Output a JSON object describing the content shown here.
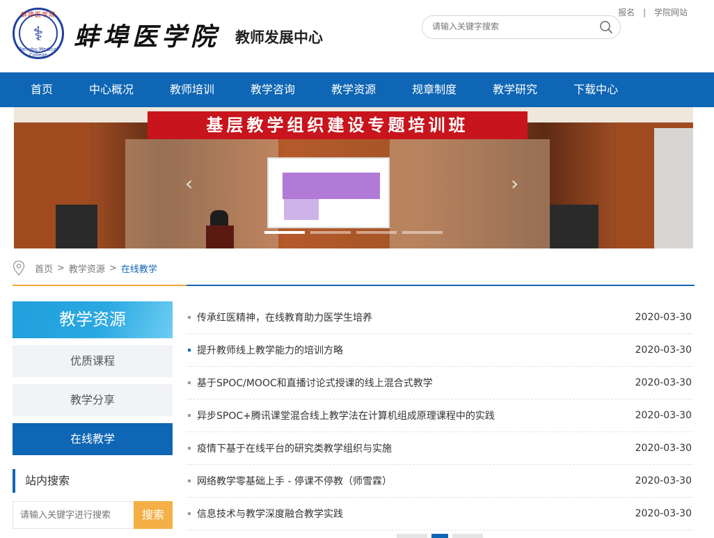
{
  "header": {
    "college_name": "蚌埠医学院",
    "center_name": "教师发展中心",
    "logo_ring_top": "蚌埠医学院",
    "logo_ring_bottom": "Bengbu Medical College",
    "top_links": [
      "报名",
      "学院网站"
    ],
    "top_link_separator": "|",
    "search_placeholder": "请输入关键字搜索"
  },
  "nav": {
    "items": [
      "首页",
      "中心概况",
      "教师培训",
      "教学咨询",
      "教学资源",
      "规章制度",
      "教学研究",
      "下载中心"
    ]
  },
  "banner": {
    "headline": "基层教学组织建设专题培训班",
    "slide_count": 4,
    "active_slide": 1
  },
  "breadcrumb": {
    "items": [
      "首页",
      "教学资源",
      "在线教学"
    ],
    "separator": ">"
  },
  "sidebar": {
    "heading": "教学资源",
    "items": [
      {
        "label": "优质课程",
        "active": false
      },
      {
        "label": "教学分享",
        "active": false
      },
      {
        "label": "在线教学",
        "active": true
      }
    ],
    "search_title": "站内搜索",
    "search_placeholder": "请输入关键字进行搜索",
    "search_button": "搜索"
  },
  "news": [
    {
      "title": "传承红医精神，在线教育助力医学生培养",
      "date": "2020-03-30",
      "highlight": false
    },
    {
      "title": "提升教师线上教学能力的培训方略",
      "date": "2020-03-30",
      "highlight": true
    },
    {
      "title": "基于SPOC/MOOC和直播讨论式授课的线上混合式教学",
      "date": "2020-03-30",
      "highlight": false
    },
    {
      "title": "异步SPOC+腾讯课堂混合线上教学法在计算机组成原理课程中的实践",
      "date": "2020-03-30",
      "highlight": false
    },
    {
      "title": "疫情下基于在线平台的研究类教学组织与实施",
      "date": "2020-03-30",
      "highlight": false
    },
    {
      "title": "网络教学零基础上手 - 停课不停教（师雪霖）",
      "date": "2020-03-30",
      "highlight": false
    },
    {
      "title": "信息技术与教学深度融合教学实践",
      "date": "2020-03-30",
      "highlight": false
    }
  ],
  "colors": {
    "primary_blue": "#0e66b4",
    "accent_orange": "#f4b046",
    "banner_red": "#c8141c"
  }
}
